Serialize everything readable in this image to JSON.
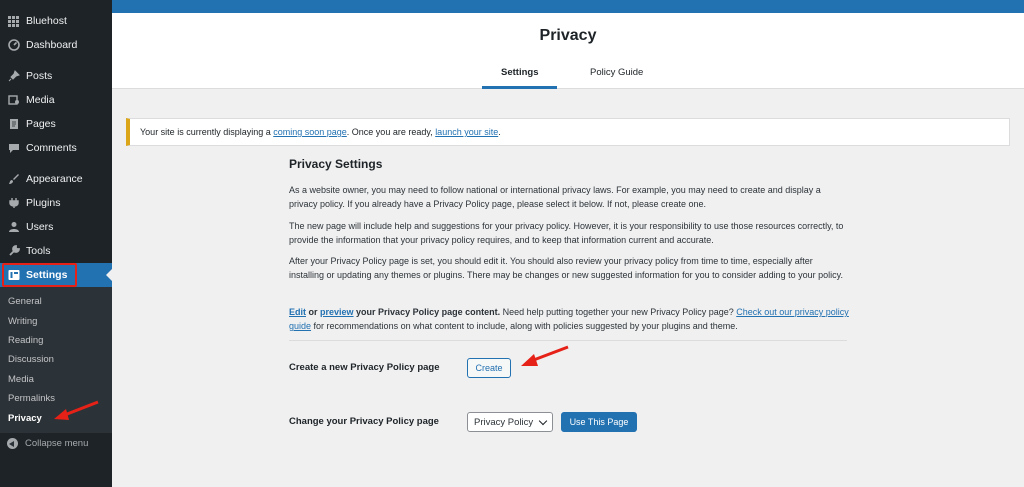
{
  "sidebar": {
    "top_items": [
      {
        "label": "Bluehost",
        "icon": "grid-icon"
      },
      {
        "label": "Dashboard",
        "icon": "dashboard-icon"
      }
    ],
    "items": [
      {
        "label": "Posts",
        "icon": "pin-icon"
      },
      {
        "label": "Media",
        "icon": "media-icon"
      },
      {
        "label": "Pages",
        "icon": "page-icon"
      },
      {
        "label": "Comments",
        "icon": "comment-icon"
      },
      {
        "label": "Appearance",
        "icon": "brush-icon"
      },
      {
        "label": "Plugins",
        "icon": "plug-icon"
      },
      {
        "label": "Users",
        "icon": "user-icon"
      },
      {
        "label": "Tools",
        "icon": "wrench-icon"
      },
      {
        "label": "Settings",
        "icon": "settings-icon"
      }
    ],
    "submenu": [
      "General",
      "Writing",
      "Reading",
      "Discussion",
      "Media",
      "Permalinks",
      "Privacy"
    ],
    "collapse_label": "Collapse menu"
  },
  "header": {
    "title": "Privacy",
    "tabs": [
      "Settings",
      "Policy Guide"
    ]
  },
  "notice": {
    "text_before": "Your site is currently displaying a ",
    "link1": "coming soon page",
    "text_middle": ". Once you are ready, ",
    "link2": "launch your site",
    "text_after": "."
  },
  "main": {
    "heading": "Privacy Settings",
    "p1": "As a website owner, you may need to follow national or international privacy laws. For example, you may need to create and display a privacy policy. If you already have a Privacy Policy page, please select it below. If not, please create one.",
    "p2": "The new page will include help and suggestions for your privacy policy. However, it is your responsibility to use those resources correctly, to provide the information that your privacy policy requires, and to keep that information current and accurate.",
    "p3": "After your Privacy Policy page is set, you should edit it. You should also review your privacy policy from time to time, especially after installing or updating any themes or plugins. There may be changes or new suggested information for you to consider adding to your policy.",
    "p4_edit": "Edit",
    "p4_or": " or ",
    "p4_preview": "preview",
    "p4_bold": " your Privacy Policy page content.",
    "p4_mid": " Need help putting together your new Privacy Policy page? ",
    "p4_link": "Check out our privacy policy guide",
    "p4_end": " for recommendations on what content to include, along with policies suggested by your plugins and theme.",
    "create_label": "Create a new Privacy Policy page",
    "create_button": "Create",
    "change_label": "Change your Privacy Policy page",
    "select_value": "Privacy Policy",
    "use_button": "Use This Page"
  },
  "colors": {
    "accent": "#2271b1",
    "sidebar_bg": "#1d2327",
    "annotation_red": "#e62117",
    "notice_border": "#dba617"
  }
}
